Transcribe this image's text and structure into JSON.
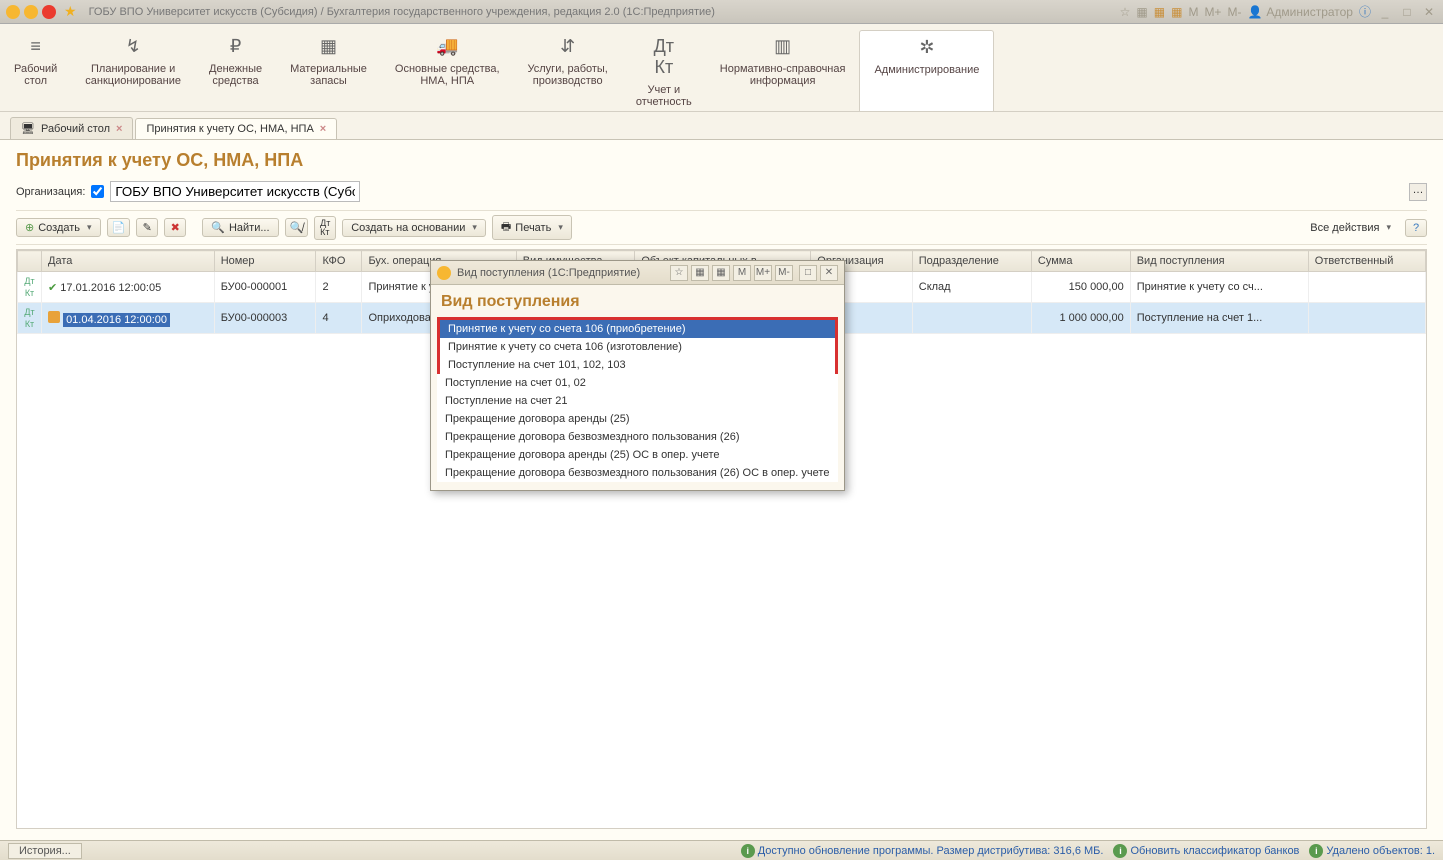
{
  "chrome": {
    "title": "ГОБУ ВПО Университет искусств (Субсидия) / Бухгалтерия государственного учреждения, редакция 2.0  (1С:Предприятие)",
    "user": "Администратор"
  },
  "sections": [
    {
      "icon": "≡",
      "label": "Рабочий\nстол"
    },
    {
      "icon": "↯",
      "label": "Планирование и\nсанкционирование"
    },
    {
      "icon": "₽",
      "label": "Денежные\nсредства"
    },
    {
      "icon": "▦",
      "label": "Материальные\nзапасы"
    },
    {
      "icon": "🚚",
      "label": "Основные средства,\nНМА, НПА"
    },
    {
      "icon": "⇵",
      "label": "Услуги, работы,\nпроизводство"
    },
    {
      "icon": "Дт\nКт",
      "label": "Учет и\nотчетность"
    },
    {
      "icon": "▥",
      "label": "Нормативно-справочная\nинформация"
    },
    {
      "icon": "✲",
      "label": "Администрирование"
    }
  ],
  "tabs": [
    {
      "label": "Рабочий стол",
      "active": false
    },
    {
      "label": "Принятия к учету ОС, НМА, НПА",
      "active": true
    }
  ],
  "page": {
    "title": "Принятия к учету ОС, НМА, НПА",
    "org_label": "Организация:",
    "org_value": "ГОБУ ВПО Университет искусств (Субсидия)"
  },
  "toolbar": {
    "create": "Создать",
    "find": "Найти...",
    "create_based": "Создать на основании",
    "print": "Печать",
    "all_actions": "Все действия"
  },
  "columns": [
    "",
    "Дата",
    "Номер",
    "КФО",
    "Бух. операция",
    "Вид имущества",
    "Объект капитальных в...",
    "Организация",
    "Подразделение",
    "Сумма",
    "Вид поступления",
    "Ответственный"
  ],
  "rows": [
    {
      "date": "17.01.2016 12:00:05",
      "num": "БУ00-000001",
      "kfo": "2",
      "op": "Принятие к учету ОС",
      "kind": "",
      "obj": "",
      "org": "",
      "dept": "Склад",
      "sum": "150 000,00",
      "vp": "Принятие к учету со сч...",
      "resp": "",
      "sel": false
    },
    {
      "date": "01.04.2016 12:00:00",
      "num": "БУ00-000003",
      "kfo": "4",
      "op": "Оприходование изли",
      "kind": "",
      "obj": "",
      "org": "",
      "dept": "",
      "sum": "1 000 000,00",
      "vp": "Поступление на счет 1...",
      "resp": "",
      "sel": true
    }
  ],
  "popup": {
    "window_title": "Вид поступления  (1С:Предприятие)",
    "heading": "Вид поступления",
    "tools": [
      "☆",
      "▦",
      "▦",
      "M",
      "M+",
      "M-"
    ],
    "items_boxed": [
      "Принятие к учету со счета 106 (приобретение)",
      "Принятие к учету со счета 106 (изготовление)",
      "Поступление на счет 101, 102, 103"
    ],
    "items_rest": [
      "Поступление на счет 01, 02",
      "Поступление на счет 21",
      "Прекращение договора аренды (25)",
      "Прекращение договора безвозмездного пользования (26)",
      "Прекращение договора аренды (25) ОС в опер. учете",
      "Прекращение договора безвозмездного пользования (26) ОС в опер. учете"
    ]
  },
  "status": {
    "history": "История...",
    "update": "Доступно обновление программы. Размер дистрибутива: 316,6 МБ.",
    "banks": "Обновить классификатор банков",
    "deleted": "Удалено объектов: 1."
  }
}
